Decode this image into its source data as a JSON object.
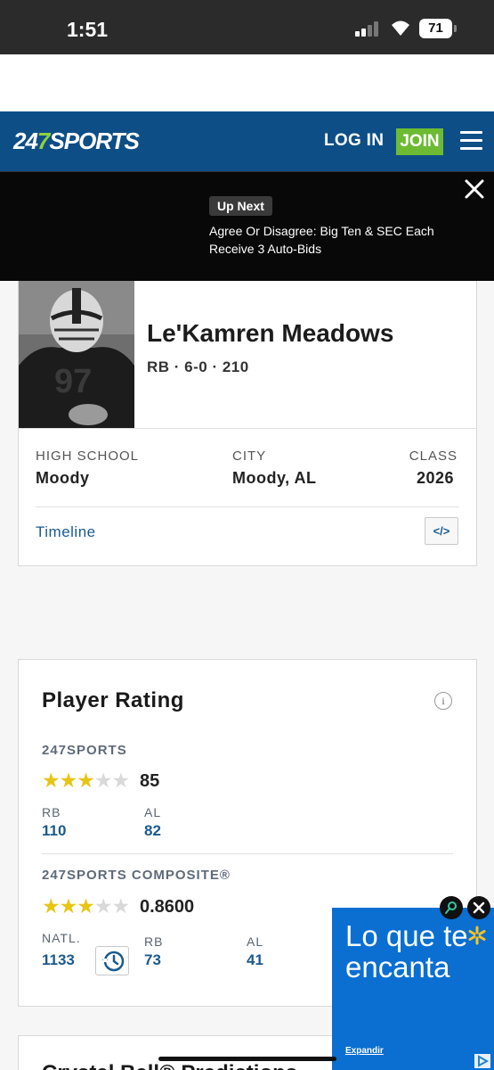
{
  "status_bar": {
    "time": "1:51",
    "battery": "71"
  },
  "header": {
    "logo_247": "24",
    "logo_7": "7",
    "logo_sports": "SPORTS",
    "login_label": "LOG IN",
    "join_label": "JOIN"
  },
  "up_next": {
    "badge": "Up Next",
    "headline": "Agree Or Disagree: Big Ten & SEC Each Receive 3 Auto-Bids"
  },
  "player": {
    "name": "Le'Kamren Meadows",
    "meta": "RB · 6-0 · 210",
    "fields": [
      {
        "label": "HIGH SCHOOL",
        "value": "Moody"
      },
      {
        "label": "CITY",
        "value": "Moody, AL"
      },
      {
        "label": "CLASS",
        "value": "2026"
      }
    ],
    "timeline_label": "Timeline",
    "embed_icon": "</>"
  },
  "rating": {
    "title": "Player Rating",
    "info_icon": "i",
    "sports247": {
      "label": "247SPORTS",
      "stars_filled": 3,
      "stars_total": 5,
      "score": "85",
      "rank_labels": [
        "RB",
        "AL"
      ],
      "rank_values": [
        "110",
        "82"
      ]
    },
    "composite": {
      "label": "247SPORTS COMPOSITE®",
      "stars_filled": 3,
      "stars_total": 5,
      "score": "0.8600",
      "rank_labels": [
        "NATL.",
        "RB",
        "AL"
      ],
      "rank_values": [
        "1133",
        "73",
        "41"
      ]
    }
  },
  "next_section": {
    "title": "Crystal Ball® Predictions"
  },
  "ad": {
    "text": "Lo que te encanta",
    "expand_label": "Expandir"
  },
  "colors": {
    "header_bg": "#0e4e86",
    "join_bg": "#6cbb33",
    "link_blue": "#1b5a8f",
    "star_gold": "#e7c515",
    "ad_blue": "#0a6fd1"
  }
}
